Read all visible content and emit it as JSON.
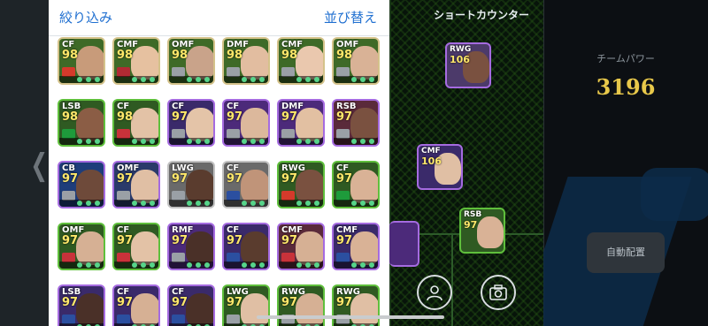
{
  "header": {
    "filter_label": "絞り込み",
    "sort_label": "並び替え"
  },
  "formation": {
    "label": "ショートカウンター"
  },
  "team_power": {
    "label": "チームパワー",
    "value": "3196"
  },
  "auto_assign_label": "自動配置",
  "player_cards": [
    {
      "position": "CF",
      "rating": "98",
      "frame": "#d4c28a",
      "bg": "#3e6a27",
      "face": "#c89b7a",
      "flag": "#d43a2b"
    },
    {
      "position": "CMF",
      "rating": "98",
      "frame": "#d4c28a",
      "bg": "#3e6a27",
      "face": "#e6c1a0",
      "flag": "#b02a33"
    },
    {
      "position": "OMF",
      "rating": "98",
      "frame": "#d4c28a",
      "bg": "#3e6a27",
      "face": "#c9a38a",
      "flag": "#9aa0a6"
    },
    {
      "position": "DMF",
      "rating": "98",
      "frame": "#d4c28a",
      "bg": "#3e6a27",
      "face": "#e2bda0",
      "flag": "#9aa0a6"
    },
    {
      "position": "CMF",
      "rating": "98",
      "frame": "#d4c28a",
      "bg": "#3e6a27",
      "face": "#eac8ae",
      "flag": "#9aa0a6"
    },
    {
      "position": "OMF",
      "rating": "98",
      "frame": "#d4c28a",
      "bg": "#3e6a27",
      "face": "#d9b296",
      "flag": "#9aa0a6"
    },
    {
      "position": "LSB",
      "rating": "98",
      "frame": "#5fbf3c",
      "bg": "#2f5a22",
      "face": "#8b5d45",
      "flag": "#1e9b3b"
    },
    {
      "position": "CF",
      "rating": "98",
      "frame": "#5fbf3c",
      "bg": "#2f5a22",
      "face": "#e3c2a6",
      "flag": "#c8323a"
    },
    {
      "position": "CF",
      "rating": "97",
      "frame": "#a56be0",
      "bg": "#3a2a6a",
      "face": "#e4c4a8",
      "flag": "#9aa0a6"
    },
    {
      "position": "CF",
      "rating": "97",
      "frame": "#a56be0",
      "bg": "#4c2a7a",
      "face": "#dcb89c",
      "flag": "#9aa0a6"
    },
    {
      "position": "DMF",
      "rating": "97",
      "frame": "#a56be0",
      "bg": "#4c2a7a",
      "face": "#e2c0a2",
      "flag": "#9aa0a6"
    },
    {
      "position": "RSB",
      "rating": "97",
      "frame": "#a56be0",
      "bg": "#5a2a3a",
      "face": "#7a5140",
      "flag": "#9aa0a6"
    },
    {
      "position": "CB",
      "rating": "97",
      "frame": "#a56be0",
      "bg": "#1e3d7a",
      "face": "#6e4a3a",
      "flag": "#9aa0a6"
    },
    {
      "position": "OMF",
      "rating": "97",
      "frame": "#a56be0",
      "bg": "#2a3a6a",
      "face": "#e0bfa4",
      "flag": "#9aa0a6"
    },
    {
      "position": "LWG",
      "rating": "97",
      "frame": "#c2c2c2",
      "bg": "#6a6a6a",
      "face": "#5a3c2e",
      "flag": "#9aa0a6"
    },
    {
      "position": "CF",
      "rating": "97",
      "frame": "#c2c2c2",
      "bg": "#6a6a6a",
      "face": "#c09479",
      "flag": "#2b4fa0"
    },
    {
      "position": "RWG",
      "rating": "97",
      "frame": "#5fbf3c",
      "bg": "#2f5a22",
      "face": "#7a5140",
      "flag": "#d43a2b"
    },
    {
      "position": "CF",
      "rating": "97",
      "frame": "#5fbf3c",
      "bg": "#2f5a22",
      "face": "#d9b296",
      "flag": "#1e9b3b"
    },
    {
      "position": "OMF",
      "rating": "97",
      "frame": "#5fbf3c",
      "bg": "#2f5a22",
      "face": "#d6b094",
      "flag": "#c8323a"
    },
    {
      "position": "CF",
      "rating": "97",
      "frame": "#5fbf3c",
      "bg": "#2f5a22",
      "face": "#e3c2a6",
      "flag": "#c8323a"
    },
    {
      "position": "RMF",
      "rating": "97",
      "frame": "#a56be0",
      "bg": "#4c2a7a",
      "face": "#4a3028",
      "flag": "#9aa0a6"
    },
    {
      "position": "CF",
      "rating": "97",
      "frame": "#a56be0",
      "bg": "#3a2a6a",
      "face": "#5a3c2e",
      "flag": "#2b4fa0"
    },
    {
      "position": "CMF",
      "rating": "97",
      "frame": "#a56be0",
      "bg": "#5a2a3a",
      "face": "#d6b094",
      "flag": "#c8323a"
    },
    {
      "position": "CMF",
      "rating": "97",
      "frame": "#a56be0",
      "bg": "#3a2a6a",
      "face": "#d9b296",
      "flag": "#2b4fa0"
    },
    {
      "position": "LSB",
      "rating": "97",
      "frame": "#a56be0",
      "bg": "#3a2a6a",
      "face": "#4a3028",
      "flag": "#2b4fa0"
    },
    {
      "position": "CF",
      "rating": "97",
      "frame": "#a56be0",
      "bg": "#3a2a6a",
      "face": "#d6b094",
      "flag": "#2b4fa0"
    },
    {
      "position": "CF",
      "rating": "97",
      "frame": "#a56be0",
      "bg": "#3a2a6a",
      "face": "#4a3028",
      "flag": "#2b4fa0"
    },
    {
      "position": "LWG",
      "rating": "97",
      "frame": "#5fbf3c",
      "bg": "#2f5a22",
      "face": "#e0bfa4",
      "flag": "#9aa0a6"
    },
    {
      "position": "RWG",
      "rating": "97",
      "frame": "#5fbf3c",
      "bg": "#2f5a22",
      "face": "#d6b094",
      "flag": "#9aa0a6"
    },
    {
      "position": "RWG",
      "rating": "97",
      "frame": "#5fbf3c",
      "bg": "#2f5a22",
      "face": "#e0bfa4",
      "flag": "#9aa0a6"
    }
  ],
  "pitch_players": [
    {
      "position": "RWG",
      "rating": "106",
      "frame": "#a56be0",
      "bg": "#4c3a6a",
      "face": "#7a5140"
    },
    {
      "position": "CMF",
      "rating": "106",
      "frame": "#a56be0",
      "bg": "#3a2a6a",
      "face": "#e0bfa4"
    },
    {
      "position": "RSB",
      "rating": "97",
      "frame": "#5fbf3c",
      "bg": "#2f5a22",
      "face": "#d9b296"
    }
  ],
  "icons": {
    "player": "person-icon",
    "camera": "camera-icon",
    "back": "chevron-left-icon"
  }
}
